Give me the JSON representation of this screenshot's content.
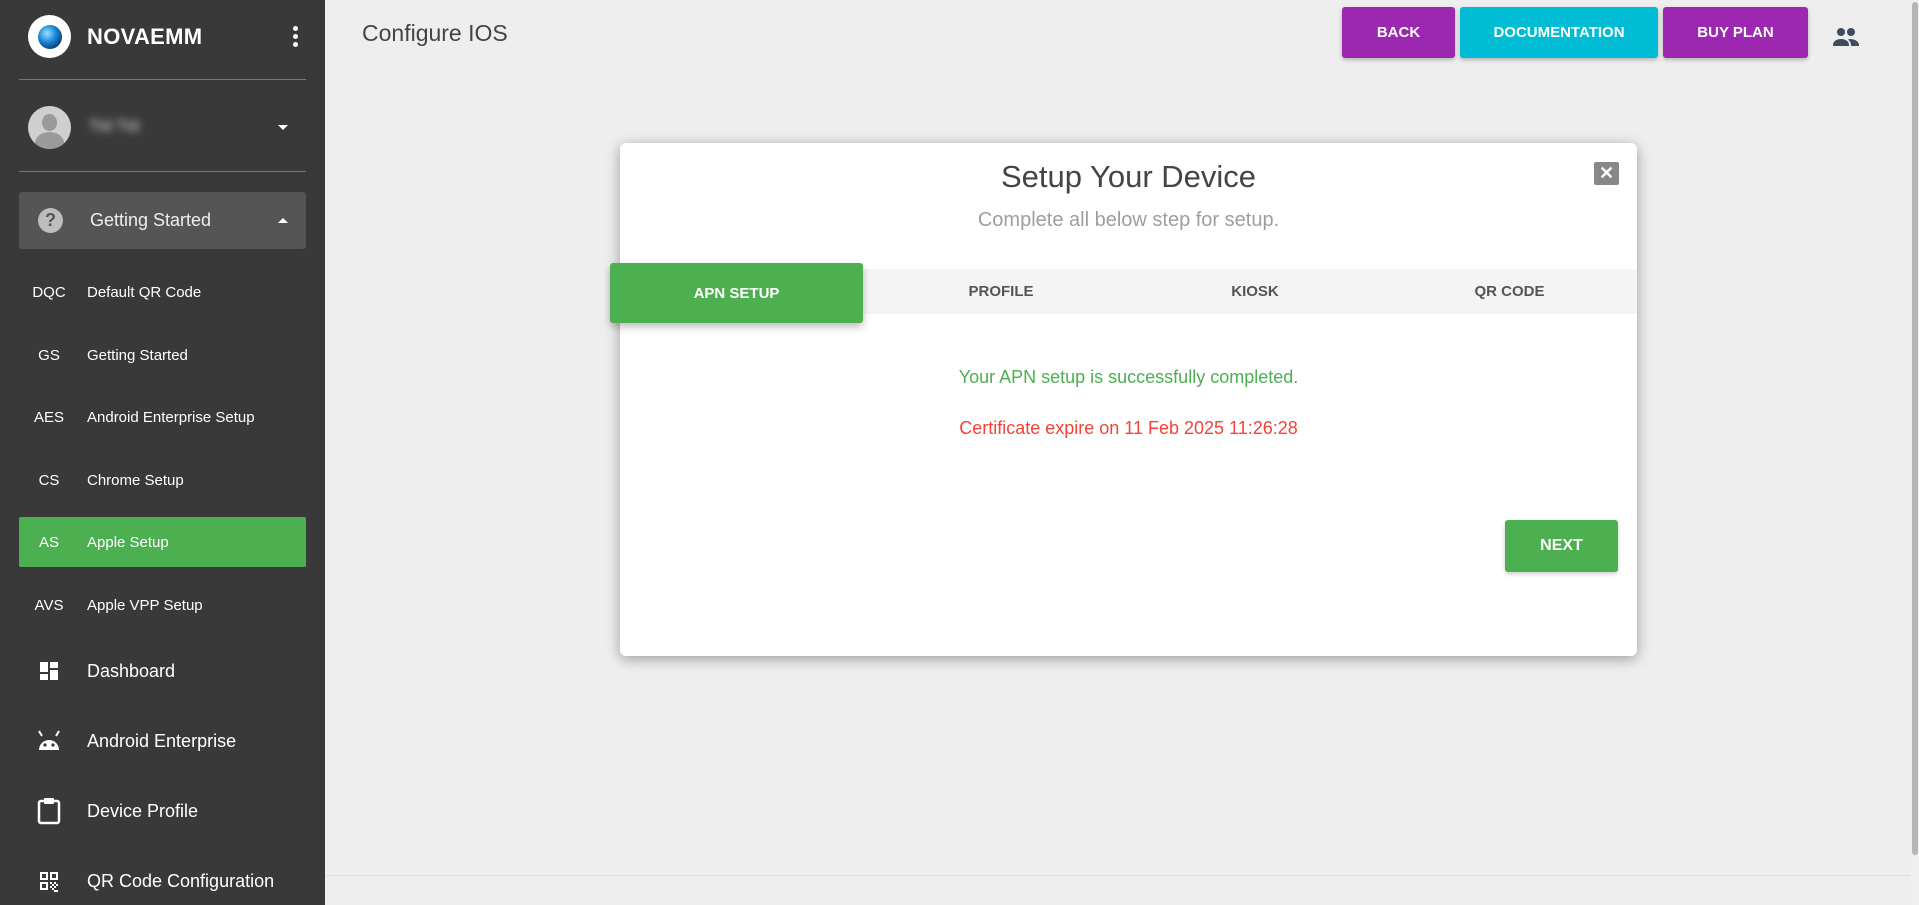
{
  "app": {
    "name": "NOVAEMM"
  },
  "user": {
    "name": "Ttd Ttd"
  },
  "sidebar": {
    "group": {
      "label": "Getting Started"
    },
    "sub_items": [
      {
        "abbr": "DQC",
        "label": "Default QR Code"
      },
      {
        "abbr": "GS",
        "label": "Getting Started"
      },
      {
        "abbr": "AES",
        "label": "Android Enterprise Setup"
      },
      {
        "abbr": "CS",
        "label": "Chrome Setup"
      },
      {
        "abbr": "AS",
        "label": "Apple Setup"
      },
      {
        "abbr": "AVS",
        "label": "Apple VPP Setup"
      }
    ],
    "active_item": "Apple Setup",
    "main_items": [
      {
        "label": "Dashboard",
        "icon": "dashboard-icon"
      },
      {
        "label": "Android Enterprise",
        "icon": "android-icon"
      },
      {
        "label": "Device Profile",
        "icon": "clipboard-icon"
      },
      {
        "label": "QR Code Configuration",
        "icon": "qr-code-icon"
      }
    ]
  },
  "header": {
    "title": "Configure IOS",
    "back": "BACK",
    "documentation": "DOCUMENTATION",
    "buy_plan": "BUY PLAN"
  },
  "modal": {
    "title": "Setup Your Device",
    "subtitle": "Complete all below step for setup.",
    "tabs": [
      "APN SETUP",
      "PROFILE",
      "KIOSK",
      "QR CODE"
    ],
    "active_tab": "APN SETUP",
    "success_message": "Your APN setup is successfully completed.",
    "expiry_message": "Certificate expire on 11 Feb 2025 11:26:28",
    "next": "NEXT"
  },
  "colors": {
    "sidebar_bg": "#393939",
    "accent_green": "#4caf50",
    "purple": "#9c27b0",
    "cyan": "#00bcd4",
    "error_red": "#f44336"
  }
}
